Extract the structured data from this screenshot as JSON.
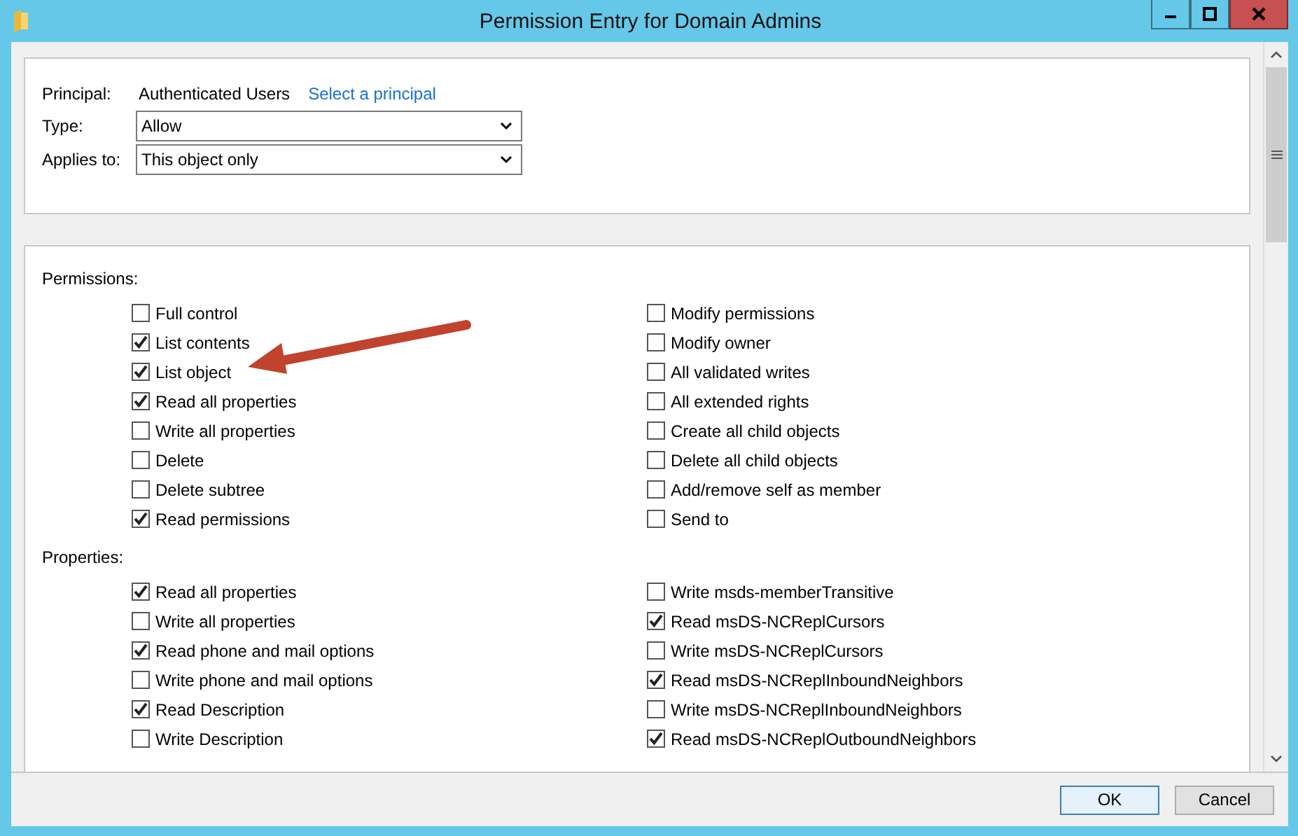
{
  "window": {
    "title": "Permission Entry for Domain Admins"
  },
  "principal": {
    "label": "Principal:",
    "value": "Authenticated Users",
    "link": "Select a principal"
  },
  "type": {
    "label": "Type:",
    "value": "Allow"
  },
  "applies_to": {
    "label": "Applies to:",
    "value": "This object only"
  },
  "permissions": {
    "heading": "Permissions:",
    "left": [
      {
        "label": "Full control",
        "checked": false
      },
      {
        "label": "List contents",
        "checked": true
      },
      {
        "label": "List object",
        "checked": true
      },
      {
        "label": "Read all properties",
        "checked": true
      },
      {
        "label": "Write all properties",
        "checked": false
      },
      {
        "label": "Delete",
        "checked": false
      },
      {
        "label": "Delete subtree",
        "checked": false
      },
      {
        "label": "Read permissions",
        "checked": true
      }
    ],
    "right": [
      {
        "label": "Modify permissions",
        "checked": false
      },
      {
        "label": "Modify owner",
        "checked": false
      },
      {
        "label": "All validated writes",
        "checked": false
      },
      {
        "label": "All extended rights",
        "checked": false
      },
      {
        "label": "Create all child objects",
        "checked": false
      },
      {
        "label": "Delete all child objects",
        "checked": false
      },
      {
        "label": "Add/remove self as member",
        "checked": false
      },
      {
        "label": "Send to",
        "checked": false
      }
    ]
  },
  "properties": {
    "heading": "Properties:",
    "left": [
      {
        "label": "Read all properties",
        "checked": true
      },
      {
        "label": "Write all properties",
        "checked": false
      },
      {
        "label": "Read phone and mail options",
        "checked": true
      },
      {
        "label": "Write phone and mail options",
        "checked": false
      },
      {
        "label": "Read Description",
        "checked": true
      },
      {
        "label": "Write Description",
        "checked": false
      }
    ],
    "right": [
      {
        "label": "Write msds-memberTransitive",
        "checked": false
      },
      {
        "label": "Read msDS-NCReplCursors",
        "checked": true
      },
      {
        "label": "Write msDS-NCReplCursors",
        "checked": false
      },
      {
        "label": "Read msDS-NCReplInboundNeighbors",
        "checked": true
      },
      {
        "label": "Write msDS-NCReplInboundNeighbors",
        "checked": false
      },
      {
        "label": "Read msDS-NCReplOutboundNeighbors",
        "checked": true
      }
    ]
  },
  "buttons": [
    "OK",
    "Cancel"
  ]
}
